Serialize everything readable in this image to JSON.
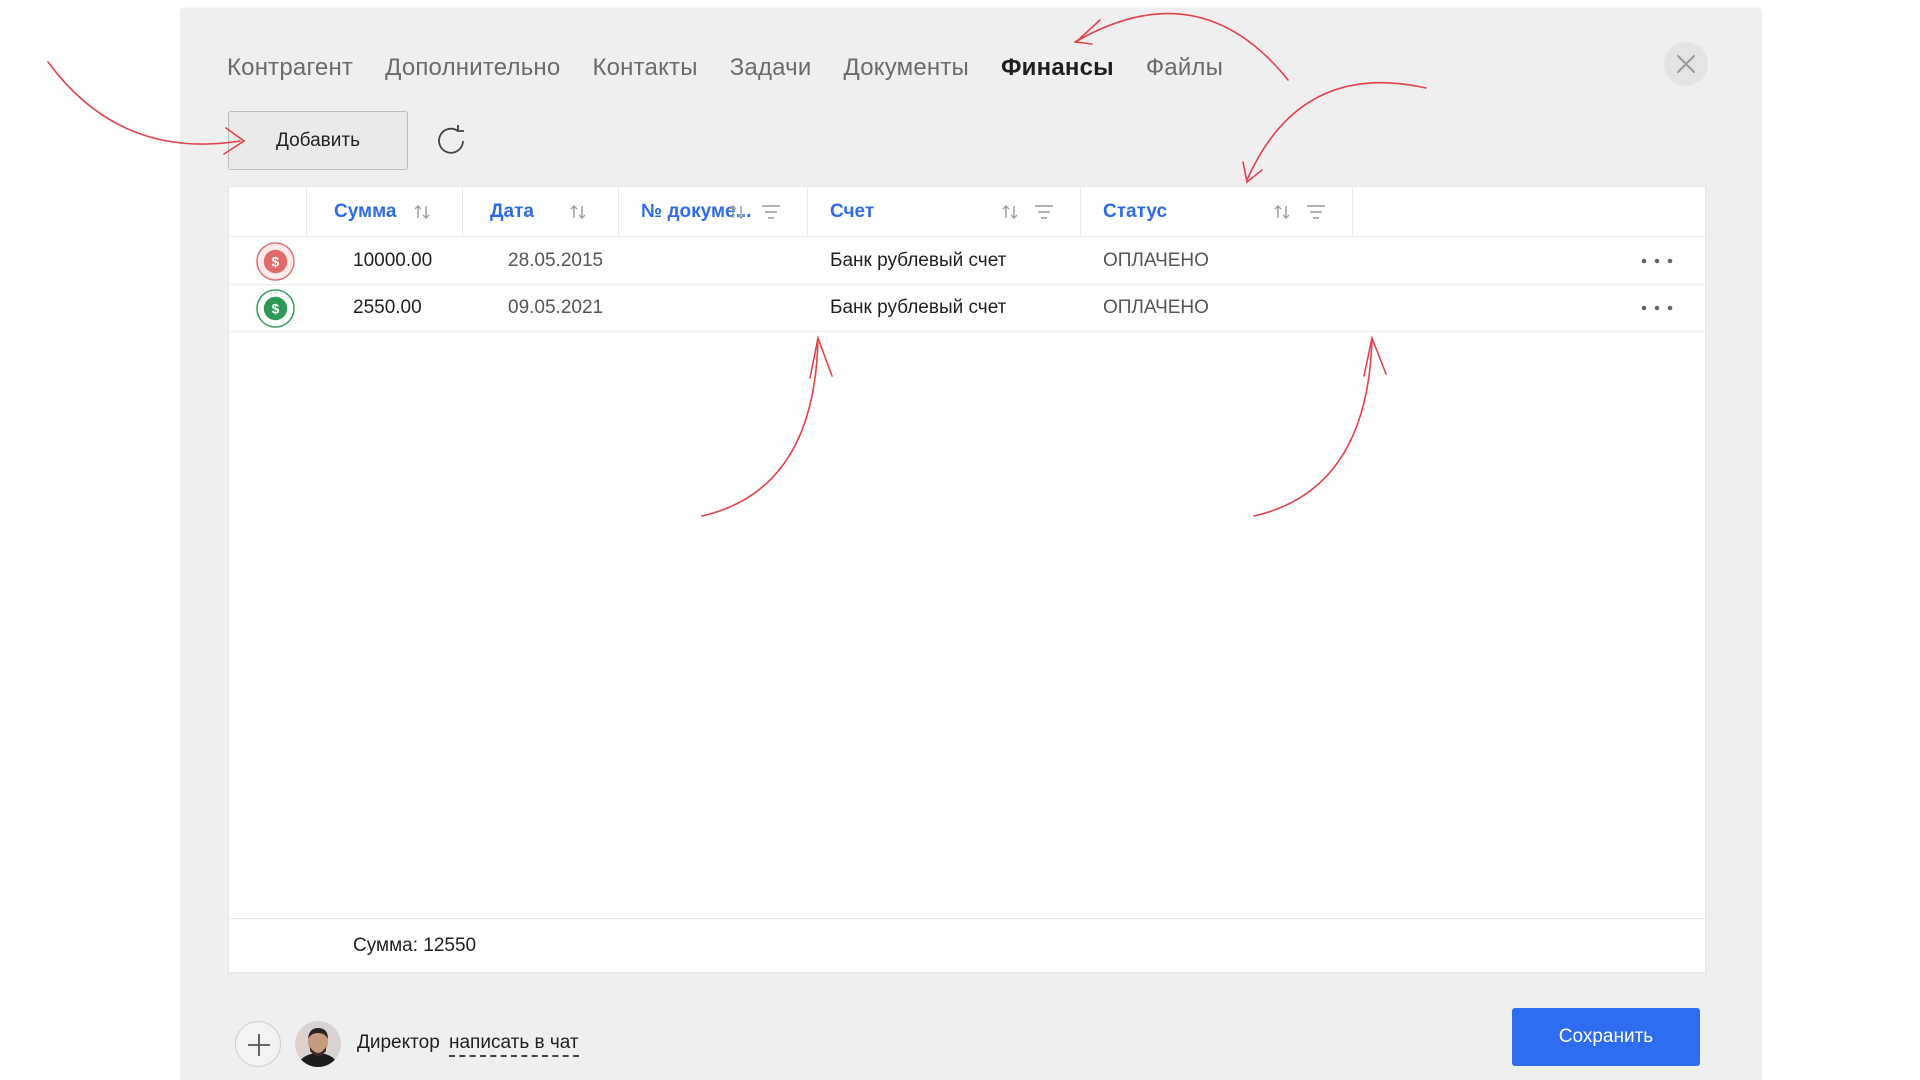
{
  "tabs": [
    {
      "label": "Контрагент"
    },
    {
      "label": "Дополнительно"
    },
    {
      "label": "Контакты"
    },
    {
      "label": "Задачи"
    },
    {
      "label": "Документы"
    },
    {
      "label": "Финансы",
      "active": true
    },
    {
      "label": "Файлы"
    }
  ],
  "toolbar": {
    "add_label": "Добавить"
  },
  "table": {
    "columns": [
      {
        "label": "Сумма"
      },
      {
        "label": "Дата"
      },
      {
        "label": "№ докуме..."
      },
      {
        "label": "Счет"
      },
      {
        "label": "Статус"
      }
    ],
    "rows": [
      {
        "amount": "10000.00",
        "date": "28.05.2015",
        "doc_number": "",
        "account": "Банк рублевый счет",
        "status": "ОПЛАЧЕНО",
        "icon": "dollar-coin-red-icon"
      },
      {
        "amount": "2550.00",
        "date": "09.05.2021",
        "doc_number": "",
        "account": "Банк рублевый счет",
        "status": "ОПЛАЧЕНО",
        "icon": "dollar-coin-green-icon"
      }
    ],
    "total_label": "Сумма: 12550"
  },
  "footer": {
    "role": "Директор",
    "chat_link": "написать в чат",
    "save_label": "Сохранить"
  },
  "colors": {
    "accent": "#2f6df0",
    "header_text": "#2f6be8",
    "annotation": "#e2434b",
    "coin_red": "#e06b6b",
    "coin_green": "#2e9a55"
  }
}
